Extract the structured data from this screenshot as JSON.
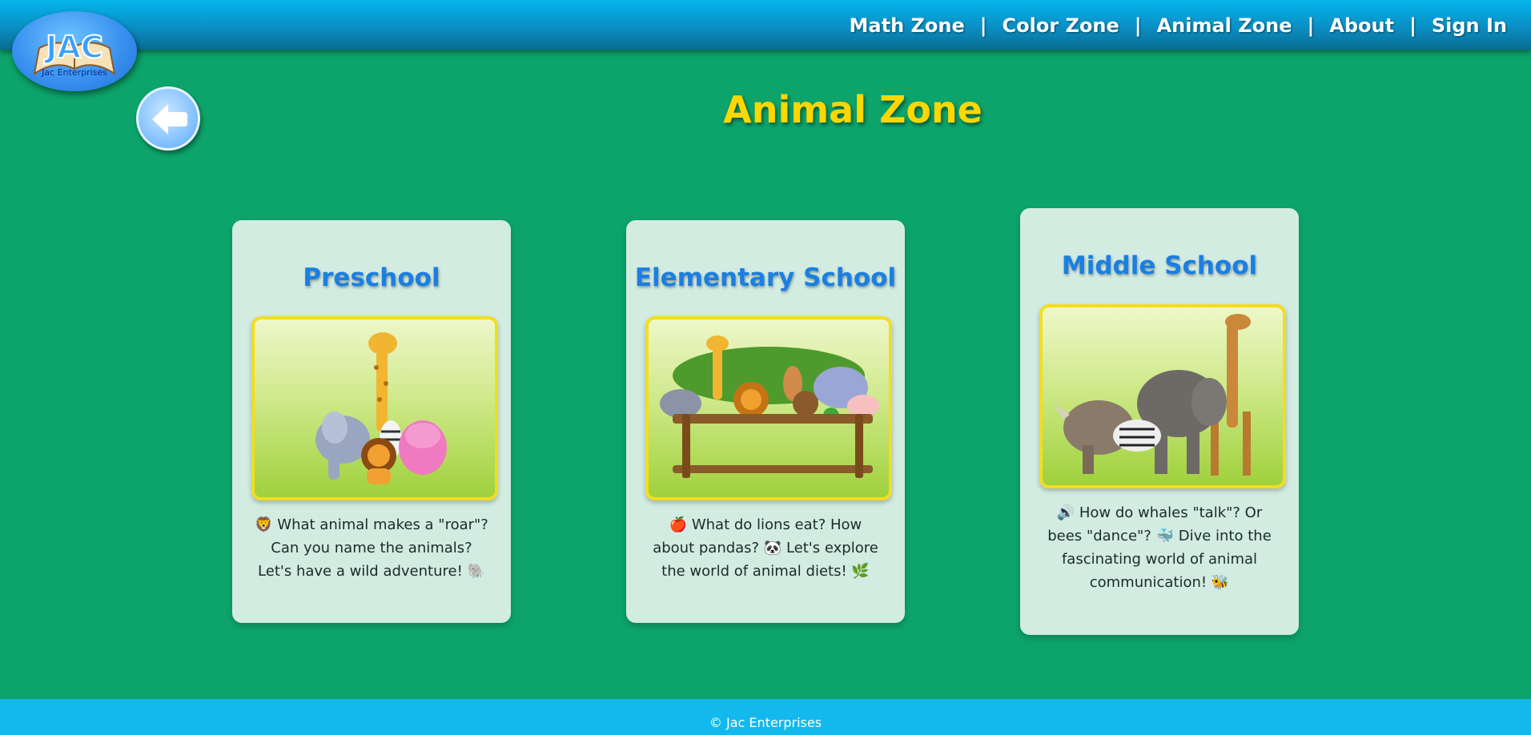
{
  "brand": {
    "logo_letters": "JAC",
    "logo_caption": "Jac Enterprises"
  },
  "nav": {
    "items": [
      "Math Zone",
      "Color Zone",
      "Animal Zone",
      "About",
      "Sign In"
    ],
    "separator": "|"
  },
  "page": {
    "title": "Animal Zone"
  },
  "cards": [
    {
      "title": "Preschool",
      "image": "preschool-animals-group",
      "description": "🦁 What animal makes a \"roar\"? Can you name the animals? Let's have a wild adventure! 🐘"
    },
    {
      "title": "Elementary School",
      "image": "elementary-animals-sign",
      "description": "🍎 What do lions eat? How about pandas? 🐼 Let's explore the world of animal diets! 🌿"
    },
    {
      "title": "Middle School",
      "image": "middle-school-safari-animals",
      "description": "🔊 How do whales \"talk\"? Or bees \"dance\"? 🐳 Dive into the fascinating world of animal communication! 🐝"
    }
  ],
  "footer": {
    "copyright": "© Jac Enterprises"
  },
  "colors": {
    "background": "#0ca46a",
    "header": "#0a8fc4",
    "title": "#ffd700",
    "card_title": "#1a7fe3",
    "card_bg": "#d2ece2",
    "footer": "#13b9ec"
  }
}
